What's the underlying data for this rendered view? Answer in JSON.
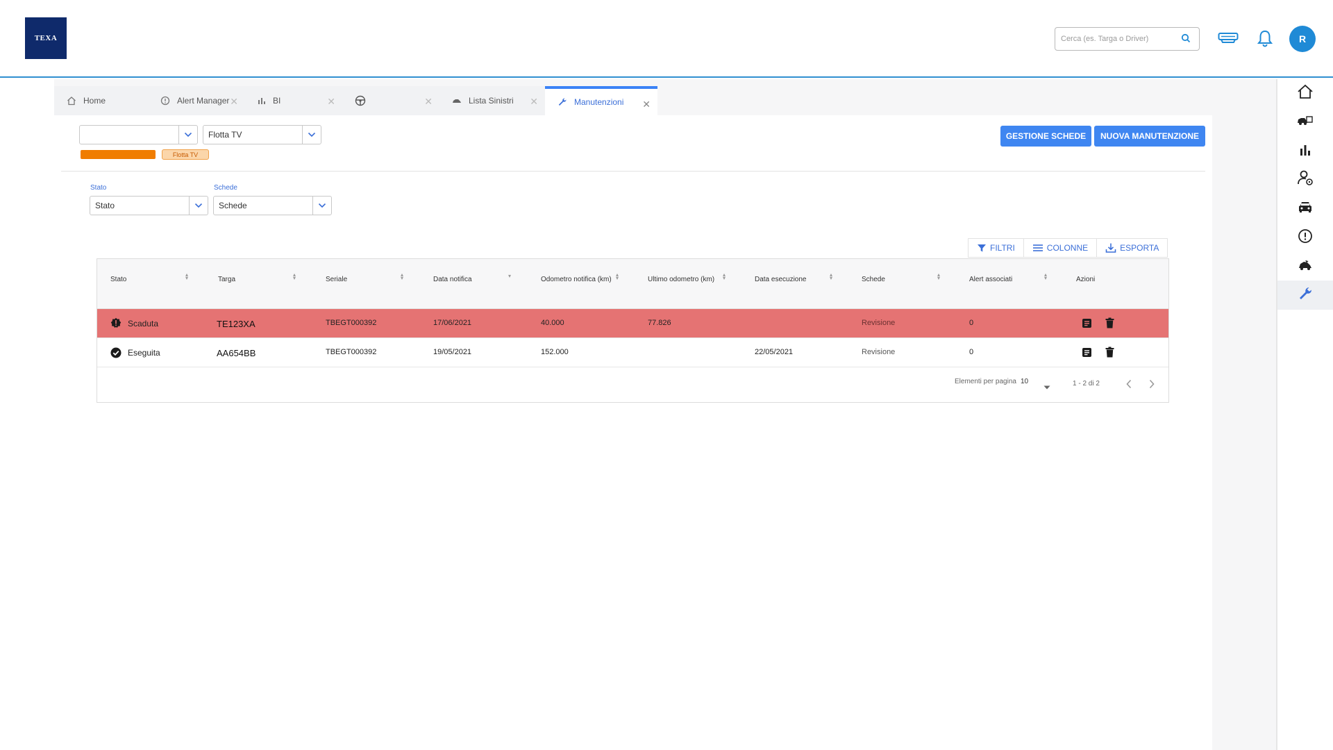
{
  "header": {
    "logo_text": "TEXA",
    "search_placeholder": "Cerca (es. Targa o Driver)",
    "avatar_initial": "R"
  },
  "tabs": [
    {
      "label": "Home",
      "icon": "home-icon",
      "closable": false
    },
    {
      "label": "Alert Manager",
      "icon": "alert-circle-icon",
      "closable": true
    },
    {
      "label": "BI",
      "icon": "bar-chart-icon",
      "closable": true
    },
    {
      "label": "",
      "icon": "steering-wheel-icon",
      "closable": true
    },
    {
      "label": "Lista Sinistri",
      "icon": "car-crash-icon",
      "closable": true
    },
    {
      "label": "Manutenzioni",
      "icon": "wrench-icon",
      "closable": true,
      "active": true
    }
  ],
  "filters": {
    "company_select_value": "",
    "fleet_select_value": "Flotta TV",
    "fleet_chip": "Flotta TV",
    "stato_label": "Stato",
    "stato_value": "Stato",
    "schede_label": "Schede",
    "schede_value": "Schede"
  },
  "actions": {
    "gestione_schede": "GESTIONE SCHEDE",
    "nuova_manutenzione": "NUOVA MANUTENZIONE"
  },
  "toolbar": {
    "filtri": "FILTRI",
    "colonne": "COLONNE",
    "esporta": "ESPORTA"
  },
  "table": {
    "columns": [
      "Stato",
      "Targa",
      "Seriale",
      "Data notifica",
      "Odometro notifica (km)",
      "Ultimo odometro (km)",
      "Data esecuzione",
      "Schede",
      "Alert associati",
      "Azioni"
    ],
    "rows": [
      {
        "stato": "Scaduta",
        "targa": "TE123XA",
        "seriale": "TBEGT000392",
        "data_notifica": "17/06/2021",
        "odometro_notifica": "40.000",
        "ultimo_odometro": "77.826",
        "data_esecuzione": "",
        "schede": "Revisione",
        "alert": "0"
      },
      {
        "stato": "Eseguita",
        "targa": "AA654BB",
        "seriale": "TBEGT000392",
        "data_notifica": "19/05/2021",
        "odometro_notifica": "152.000",
        "ultimo_odometro": "",
        "data_esecuzione": "22/05/2021",
        "schede": "Revisione",
        "alert": "0"
      }
    ]
  },
  "pagination": {
    "per_page_label": "Elementi per pagina",
    "per_page_value": "10",
    "range": "1 - 2 di 2"
  },
  "colors": {
    "accent": "#3f86f1",
    "header_line": "#2f8fd0",
    "expired_row": "#e57373",
    "fleet_bar": "#f07d00",
    "logo_bg": "#0f2a6b"
  }
}
